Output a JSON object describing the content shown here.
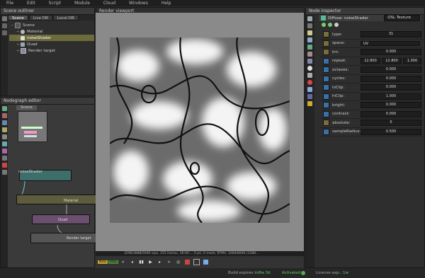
{
  "menu": [
    "File",
    "Edit",
    "Script",
    "Module",
    "Cloud",
    "Windows",
    "Help"
  ],
  "scene_outliner": {
    "title": "Scene outliner",
    "tabs": [
      "Scene",
      "Live DB",
      "Local DB"
    ],
    "items": [
      {
        "label": "Scene",
        "depth": 0,
        "selected": false
      },
      {
        "label": "Material",
        "depth": 1,
        "selected": false
      },
      {
        "label": "noiseShader",
        "depth": 1,
        "selected": true
      },
      {
        "label": "Quad",
        "depth": 1,
        "selected": false
      },
      {
        "label": "Render target",
        "depth": 1,
        "selected": false
      }
    ]
  },
  "nodegraph": {
    "title": "Nodegraph editor",
    "tab": "Scene",
    "nodes": {
      "noise": "noiseShader",
      "material": "Material",
      "quad": "Quad",
      "render": "Render target"
    }
  },
  "viewport": {
    "title": "Render viewport",
    "status": "3296/3888/5000 s/px, 155 Hz/sec, 36:00.... 0 pri, 0 mesh, RTMV, 1000/8000 (1288...",
    "transport_buttons": [
      "«",
      "◂",
      "▮▮",
      "▶",
      "▸",
      "»",
      "◎"
    ]
  },
  "inspector": {
    "title": "Node inspector",
    "node_name": "Diffuse: noiseShader",
    "node_type": "OSL Texture",
    "properties": [
      {
        "label": "type:",
        "values": [
          "31"
        ],
        "enabled": true
      },
      {
        "label": "space:",
        "values": [
          "UV"
        ],
        "enabled": true
      },
      {
        "label": "trn:",
        "values": [
          "0.000"
        ],
        "enabled": true
      },
      {
        "label": "repeat:",
        "values": [
          "12.800",
          "12.800",
          "1.000"
        ],
        "enabled": true
      },
      {
        "label": "octaves:",
        "values": [
          "0.000"
        ],
        "enabled": true
      },
      {
        "label": "cycles:",
        "values": [
          "0.000"
        ],
        "enabled": true
      },
      {
        "label": "loClip:",
        "values": [
          "0.000"
        ],
        "enabled": true
      },
      {
        "label": "hiClip:",
        "values": [
          "1.000"
        ],
        "enabled": true
      },
      {
        "label": "bright:",
        "values": [
          "0.000"
        ],
        "enabled": true
      },
      {
        "label": "contrast:",
        "values": [
          "0.000"
        ],
        "enabled": true
      },
      {
        "label": "absolute:",
        "values": [
          "0"
        ],
        "enabled": false
      },
      {
        "label": "sampleRadius:",
        "values": [
          "0.500"
        ],
        "enabled": true
      }
    ]
  },
  "bottom": {
    "build_label": "Build expires in:",
    "build_value": "8w 3d",
    "activated_label": "Activated",
    "license_label": "License exp.:",
    "license_value": "1w"
  },
  "colors": {
    "selection": "#6d6a3b",
    "accent": "#3b6fa8"
  }
}
